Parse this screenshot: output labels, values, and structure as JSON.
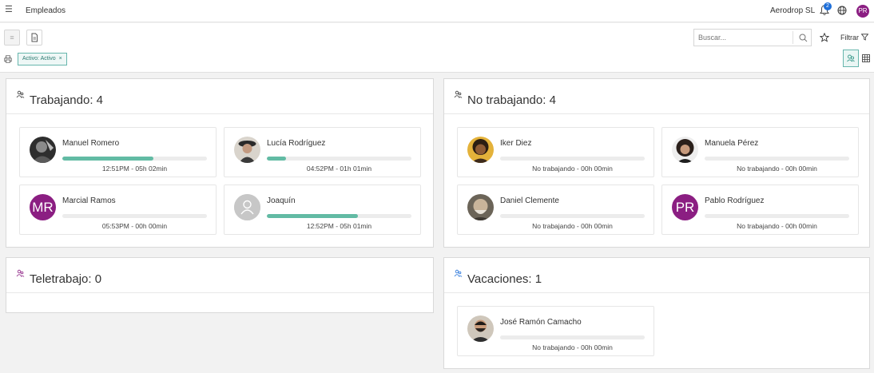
{
  "app": {
    "title": "Empleados",
    "company": "Aerodrop SL",
    "notifications_count": "2",
    "user_initials": "PR"
  },
  "toolbar": {
    "search_placeholder": "Buscar...",
    "filter_label": "Filtrar",
    "active_filter_chip": "Activo: Activo",
    "chip_close": "×"
  },
  "colors": {
    "accent": "#62bba4",
    "avatar_purple": "#8b1e82",
    "badge_blue": "#1e6fd9"
  },
  "groups": [
    {
      "id": "trabajando",
      "title": "Trabajando: 4",
      "employees": [
        {
          "name": "Manuel Romero",
          "status": "12:51PM - 05h 02min",
          "progress": 0.63,
          "avatar": "photo-dark"
        },
        {
          "name": "Lucía Rodríguez",
          "status": "04:52PM - 01h 01min",
          "progress": 0.13,
          "avatar": "photo-woman-hat"
        },
        {
          "name": "Marcial Ramos",
          "status": "05:53PM - 00h 00min",
          "progress": 0.0,
          "avatar": "initials",
          "initials": "MR"
        },
        {
          "name": "Joaquín",
          "status": "12:52PM - 05h 01min",
          "progress": 0.63,
          "avatar": "placeholder"
        }
      ]
    },
    {
      "id": "no-trabajando",
      "title": "No trabajando: 4",
      "employees": [
        {
          "name": "Iker Diez",
          "status": "No trabajando - 00h 00min",
          "progress": 0.0,
          "avatar": "photo-curly"
        },
        {
          "name": "Manuela Pérez",
          "status": "No trabajando - 00h 00min",
          "progress": 0.0,
          "avatar": "photo-curly-woman"
        },
        {
          "name": "Daniel Clemente",
          "status": "No trabajando - 00h 00min",
          "progress": 0.0,
          "avatar": "photo-elder"
        },
        {
          "name": "Pablo Rodríguez",
          "status": "No trabajando - 00h 00min",
          "progress": 0.0,
          "avatar": "initials",
          "initials": "PR"
        }
      ]
    },
    {
      "id": "teletrabajo",
      "title": "Teletrabajo: 0",
      "employees": []
    },
    {
      "id": "vacaciones",
      "title": "Vacaciones: 1",
      "employees": [
        {
          "name": "José Ramón Camacho",
          "status": "No trabajando - 00h 00min",
          "progress": 0.0,
          "avatar": "photo-beard"
        }
      ]
    }
  ]
}
